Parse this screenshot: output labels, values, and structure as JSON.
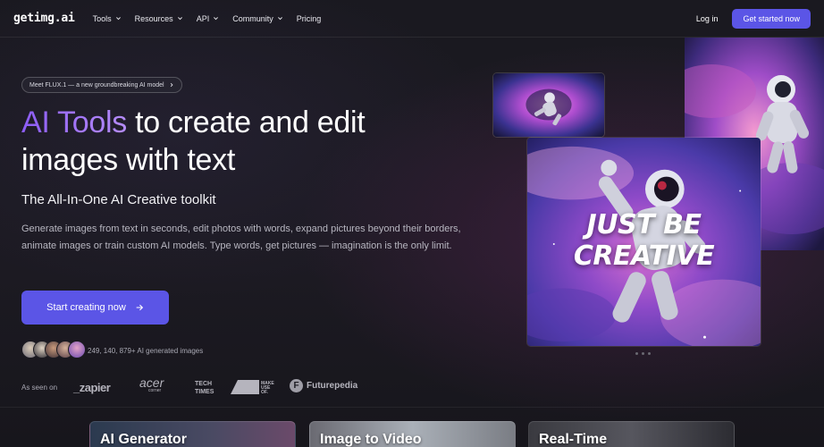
{
  "brand": {
    "logo_text": "getimg.ai"
  },
  "nav": {
    "items": [
      {
        "label": "Tools",
        "has_dropdown": true
      },
      {
        "label": "Resources",
        "has_dropdown": true
      },
      {
        "label": "API",
        "has_dropdown": true
      },
      {
        "label": "Community",
        "has_dropdown": true
      },
      {
        "label": "Pricing",
        "has_dropdown": false
      }
    ],
    "login_label": "Log in",
    "cta_label": "Get started now"
  },
  "hero": {
    "announcement": "Meet FLUX.1 — a new groundbreaking AI model",
    "headline_accent": "AI Tools",
    "headline_rest": " to create and edit images with text",
    "subtitle": "The All-In-One AI Creative toolkit",
    "description": "Generate images from text in seconds, edit photos with words, expand pictures beyond their borders, animate images or train custom AI models. Type words, get pictures — imagination is the only limit.",
    "cta_label": "Start creating now",
    "stats_text": "249, 140, 879+ AI generated images",
    "image_caption": "JUST BE CREATIVE"
  },
  "as_seen_on": {
    "label": "As seen on",
    "brands": [
      {
        "name": "zapier",
        "text": "_zapier"
      },
      {
        "name": "acer",
        "text": "acer",
        "sub": "corner"
      },
      {
        "name": "techtimes",
        "text": "TECH TIMES"
      },
      {
        "name": "makeuseof",
        "text": "MAKE USE OF."
      },
      {
        "name": "futurepedia",
        "text": "Futurepedia",
        "mark": "F"
      }
    ]
  },
  "cards": [
    {
      "label": "AI Generator"
    },
    {
      "label": "Image to Video"
    },
    {
      "label": "Real-Time"
    }
  ],
  "colors": {
    "background": "#15141a",
    "accent": "#5b55e6",
    "headline_gradient_start": "#8c5cf6",
    "headline_gradient_end": "#b58cf8"
  },
  "icons": {
    "nav_dropdown": "chevron-down-icon",
    "pill_arrow": "chevron-right-icon",
    "cta_arrow": "arrow-right-icon"
  }
}
